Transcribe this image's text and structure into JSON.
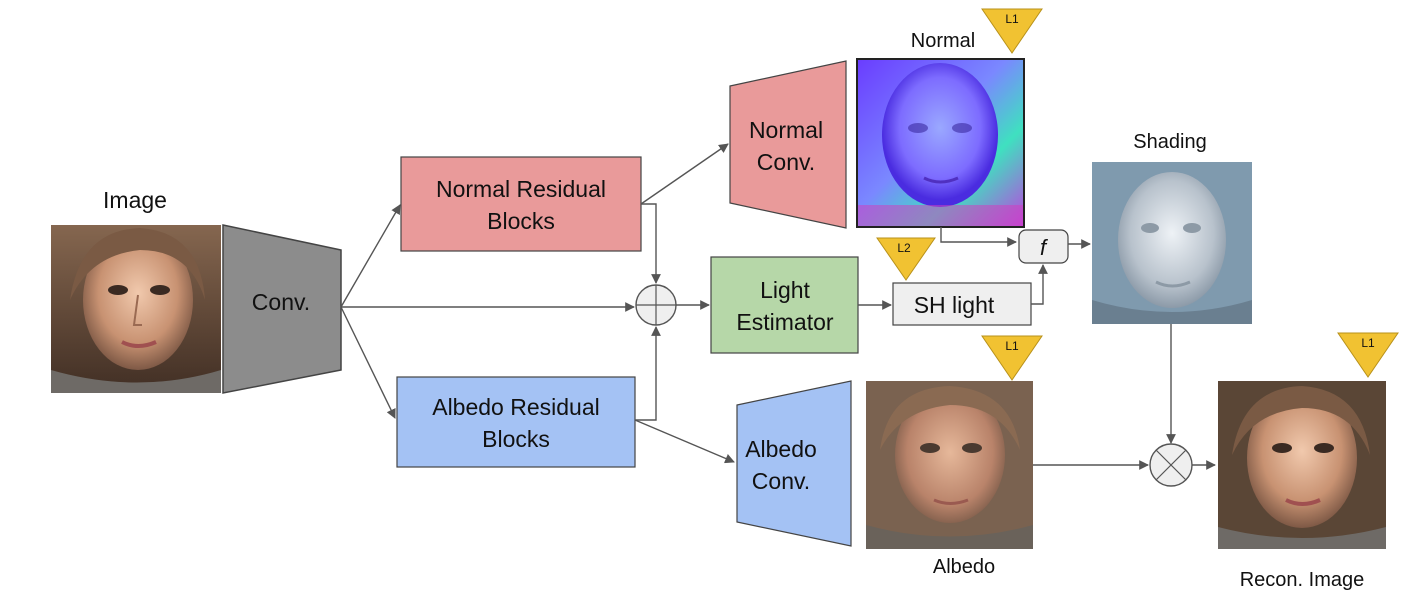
{
  "labels": {
    "image": "Image",
    "conv": "Conv.",
    "normal_res_line1": "Normal Residual",
    "normal_res_line2": "Blocks",
    "albedo_res_line1": "Albedo Residual",
    "albedo_res_line2": "Blocks",
    "normal_conv_line1": "Normal",
    "normal_conv_line2": "Conv.",
    "albedo_conv_line1": "Albedo",
    "albedo_conv_line2": "Conv.",
    "light_est_line1": "Light",
    "light_est_line2": "Estimator",
    "sh_light": "SH light",
    "f_symbol": "f",
    "normal_out": "Normal",
    "albedo_out": "Albedo",
    "shading_out": "Shading",
    "recon_out": "Recon. Image"
  },
  "loss_badges": {
    "normal": "L1",
    "light": "L2",
    "albedo": "L1",
    "recon": "L1"
  },
  "colors": {
    "conv": "#8c8c8c",
    "normal_block": "#e99a9a",
    "albedo_block": "#a4c2f4",
    "light_block": "#b6d7a8",
    "sh_box": "#efefef",
    "badge": "#f1c232",
    "arrow": "#555555"
  }
}
